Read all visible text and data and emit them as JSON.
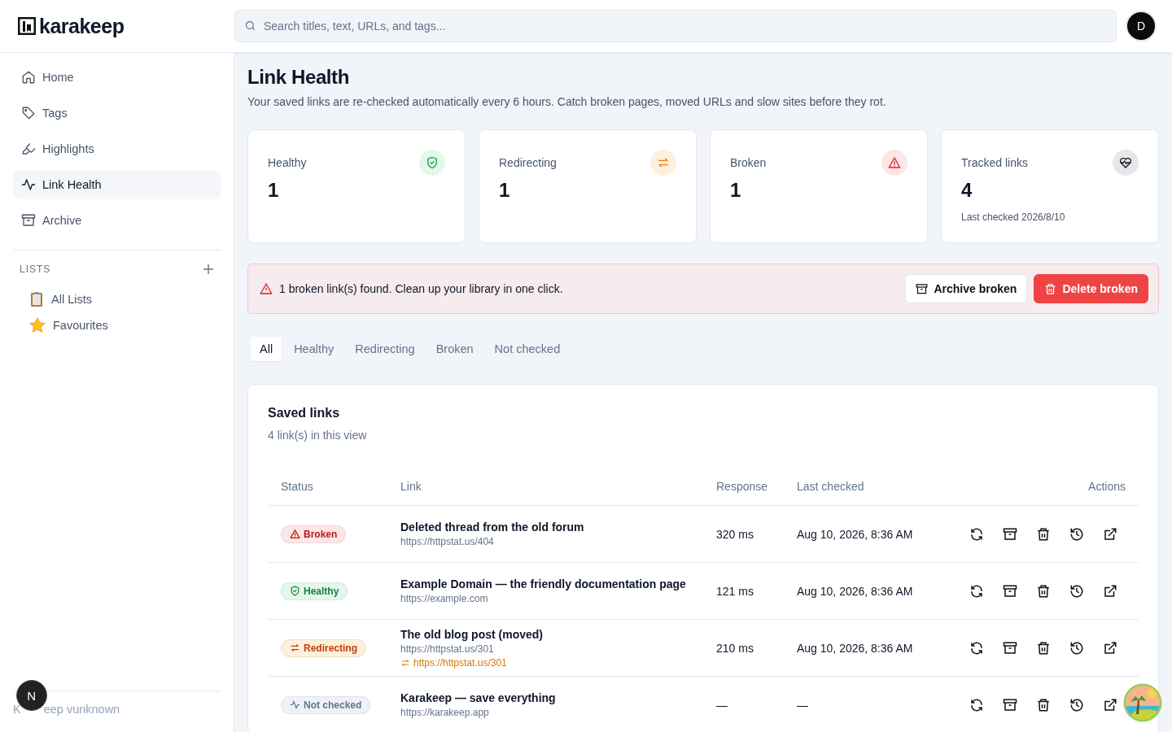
{
  "brand": "karakeep",
  "search": {
    "placeholder": "Search titles, text, URLs, and tags..."
  },
  "avatar": "D",
  "nav": [
    {
      "label": "Home",
      "selected": false
    },
    {
      "label": "Tags",
      "selected": false
    },
    {
      "label": "Highlights",
      "selected": false
    },
    {
      "label": "Link Health",
      "selected": true
    },
    {
      "label": "Archive",
      "selected": false
    }
  ],
  "lists": {
    "heading": "LISTS",
    "items": [
      {
        "label": "All Lists"
      },
      {
        "label": "Favourites"
      }
    ]
  },
  "footer": {
    "before": "K",
    "badge": "N",
    "after": "eep vunknown"
  },
  "page": {
    "title": "Link Health",
    "subtitle": "Your saved links are re-checked automatically every 6 hours. Catch broken pages, moved URLs and slow sites before they rot."
  },
  "stats": [
    {
      "kind": "healthy",
      "label": "Healthy",
      "value": "1"
    },
    {
      "kind": "redirecting",
      "label": "Redirecting",
      "value": "1"
    },
    {
      "kind": "broken",
      "label": "Broken",
      "value": "1"
    },
    {
      "kind": "tracked",
      "label": "Tracked links",
      "value": "4",
      "note": "Last checked 2026/8/10"
    }
  ],
  "alert": {
    "message": "1 broken link(s) found. Clean up your library in one click.",
    "buttons": [
      {
        "kind": "archive",
        "label": "Archive broken"
      },
      {
        "kind": "delete",
        "label": "Delete broken"
      }
    ]
  },
  "tabs": [
    {
      "label": "All",
      "selected": true
    },
    {
      "label": "Healthy",
      "selected": false
    },
    {
      "label": "Redirecting",
      "selected": false
    },
    {
      "label": "Broken",
      "selected": false
    },
    {
      "label": "Not checked",
      "selected": false
    }
  ],
  "table": {
    "title": "Saved links",
    "subtitle": "4 link(s) in this view",
    "columns": [
      "Status",
      "Link",
      "Response",
      "Last checked",
      "Actions"
    ],
    "rows": [
      {
        "status": {
          "kind": "broken",
          "label": "Broken"
        },
        "title": "Deleted thread from the old forum",
        "url": "https://httpstat.us/404",
        "response": "320 ms",
        "last_checked": "Aug 10, 2026, 8:36 AM"
      },
      {
        "status": {
          "kind": "healthy",
          "label": "Healthy"
        },
        "title": "Example Domain — the friendly documentation page",
        "url": "https://example.com",
        "response": "121 ms",
        "last_checked": "Aug 10, 2026, 8:36 AM"
      },
      {
        "status": {
          "kind": "redirecting",
          "label": "Redirecting"
        },
        "title": "The old blog post (moved)",
        "url": "https://httpstat.us/301",
        "redirect": "https://httpstat.us/301",
        "response": "210 ms",
        "last_checked": "Aug 10, 2026, 8:36 AM"
      },
      {
        "status": {
          "kind": "unchecked",
          "label": "Not checked"
        },
        "title": "Karakeep — save everything",
        "url": "https://karakeep.app",
        "response": "—",
        "last_checked": "—"
      }
    ]
  }
}
